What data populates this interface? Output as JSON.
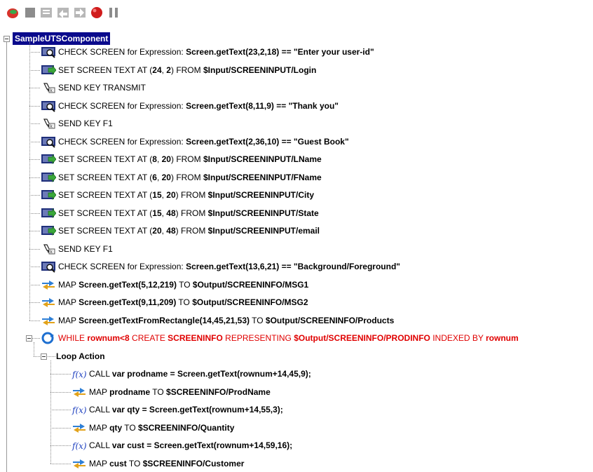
{
  "toolbar": {
    "icons": [
      "record-icon",
      "stop-icon",
      "step-into-icon",
      "step-over-icon",
      "step-out-icon",
      "breakpoint-icon",
      "pause-icon"
    ]
  },
  "tree": {
    "root": "SampleUTSComponent",
    "rows": [
      {
        "parts": [
          {
            "t": "CHECK SCREEN for Expression: ",
            "s": "kw"
          },
          {
            "t": "Screen.getText(23,2,18) == \"Enter your user-id\"",
            "s": "b"
          }
        ]
      },
      {
        "parts": [
          {
            "t": "SET SCREEN TEXT AT (",
            "s": "kw"
          },
          {
            "t": "24",
            "s": "b"
          },
          {
            "t": ", ",
            "s": "kw"
          },
          {
            "t": "2",
            "s": "b"
          },
          {
            "t": ") FROM ",
            "s": "kw"
          },
          {
            "t": "$Input/SCREENINPUT/Login",
            "s": "b"
          }
        ]
      },
      {
        "parts": [
          {
            "t": "SEND KEY TRANSMIT",
            "s": "kw"
          }
        ]
      },
      {
        "parts": [
          {
            "t": "CHECK SCREEN for Expression: ",
            "s": "kw"
          },
          {
            "t": "Screen.getText(8,11,9) == \"Thank you\"",
            "s": "b"
          }
        ]
      },
      {
        "parts": [
          {
            "t": "SEND KEY F1",
            "s": "kw"
          }
        ]
      },
      {
        "parts": [
          {
            "t": "CHECK SCREEN for Expression: ",
            "s": "kw"
          },
          {
            "t": "Screen.getText(2,36,10) == \"Guest Book\"",
            "s": "b"
          }
        ]
      },
      {
        "parts": [
          {
            "t": "SET SCREEN TEXT AT (",
            "s": "kw"
          },
          {
            "t": "8",
            "s": "b"
          },
          {
            "t": ", ",
            "s": "kw"
          },
          {
            "t": "20",
            "s": "b"
          },
          {
            "t": ") FROM ",
            "s": "kw"
          },
          {
            "t": "$Input/SCREENINPUT/LName",
            "s": "b"
          }
        ]
      },
      {
        "parts": [
          {
            "t": "SET SCREEN TEXT AT (",
            "s": "kw"
          },
          {
            "t": "6",
            "s": "b"
          },
          {
            "t": ", ",
            "s": "kw"
          },
          {
            "t": "20",
            "s": "b"
          },
          {
            "t": ") FROM ",
            "s": "kw"
          },
          {
            "t": "$Input/SCREENINPUT/FName",
            "s": "b"
          }
        ]
      },
      {
        "parts": [
          {
            "t": "SET SCREEN TEXT AT (",
            "s": "kw"
          },
          {
            "t": "15",
            "s": "b"
          },
          {
            "t": ", ",
            "s": "kw"
          },
          {
            "t": "20",
            "s": "b"
          },
          {
            "t": ") FROM ",
            "s": "kw"
          },
          {
            "t": "$Input/SCREENINPUT/City",
            "s": "b"
          }
        ]
      },
      {
        "parts": [
          {
            "t": "SET SCREEN TEXT AT (",
            "s": "kw"
          },
          {
            "t": "15",
            "s": "b"
          },
          {
            "t": ", ",
            "s": "kw"
          },
          {
            "t": "48",
            "s": "b"
          },
          {
            "t": ") FROM ",
            "s": "kw"
          },
          {
            "t": "$Input/SCREENINPUT/State",
            "s": "b"
          }
        ]
      },
      {
        "parts": [
          {
            "t": "SET SCREEN TEXT AT (",
            "s": "kw"
          },
          {
            "t": "20",
            "s": "b"
          },
          {
            "t": ", ",
            "s": "kw"
          },
          {
            "t": "48",
            "s": "b"
          },
          {
            "t": ") FROM ",
            "s": "kw"
          },
          {
            "t": "$Input/SCREENINPUT/email",
            "s": "b"
          }
        ]
      },
      {
        "parts": [
          {
            "t": "SEND KEY F1",
            "s": "kw"
          }
        ]
      },
      {
        "parts": [
          {
            "t": "CHECK SCREEN for Expression: ",
            "s": "kw"
          },
          {
            "t": "Screen.getText(13,6,21) == \"Background/Foreground\"",
            "s": "b"
          }
        ]
      },
      {
        "parts": [
          {
            "t": "MAP ",
            "s": "kw"
          },
          {
            "t": "Screen.getText(5,12,219)",
            "s": "b"
          },
          {
            "t": " TO ",
            "s": "kw"
          },
          {
            "t": "$Output/SCREENINFO/MSG1",
            "s": "b"
          }
        ]
      },
      {
        "parts": [
          {
            "t": "MAP ",
            "s": "kw"
          },
          {
            "t": "Screen.getText(9,11,209)",
            "s": "b"
          },
          {
            "t": " TO ",
            "s": "kw"
          },
          {
            "t": "$Output/SCREENINFO/MSG2",
            "s": "b"
          }
        ]
      },
      {
        "parts": [
          {
            "t": "MAP ",
            "s": "kw"
          },
          {
            "t": "Screen.getTextFromRectangle(14,45,21,53)",
            "s": "b"
          },
          {
            "t": " TO ",
            "s": "kw"
          },
          {
            "t": "$Output/SCREENINFO/Products",
            "s": "b"
          }
        ]
      },
      {
        "parts": [
          {
            "t": "WHILE ",
            "s": "kw red"
          },
          {
            "t": "rownum<8",
            "s": "b red"
          },
          {
            "t": " CREATE ",
            "s": "kw red"
          },
          {
            "t": "SCREENINFO",
            "s": "b red"
          },
          {
            "t": " REPRESENTING ",
            "s": "kw red"
          },
          {
            "t": "$Output/SCREENINFO/PRODINFO",
            "s": "b red"
          },
          {
            "t": " INDEXED BY ",
            "s": "kw red"
          },
          {
            "t": "rownum",
            "s": "b red"
          }
        ]
      },
      {
        "parts": [
          {
            "t": "Loop Action",
            "s": "b"
          }
        ]
      },
      {
        "parts": [
          {
            "t": "CALL ",
            "s": "kw"
          },
          {
            "t": "var prodname = Screen.getText(rownum+14,45,9);",
            "s": "b"
          }
        ]
      },
      {
        "parts": [
          {
            "t": "MAP ",
            "s": "kw"
          },
          {
            "t": "prodname",
            "s": "b"
          },
          {
            "t": " TO ",
            "s": "kw"
          },
          {
            "t": "$SCREENINFO/ProdName",
            "s": "b"
          }
        ]
      },
      {
        "parts": [
          {
            "t": "CALL ",
            "s": "kw"
          },
          {
            "t": "var qty = Screen.getText(rownum+14,55,3);",
            "s": "b"
          }
        ]
      },
      {
        "parts": [
          {
            "t": "MAP ",
            "s": "kw"
          },
          {
            "t": "qty",
            "s": "b"
          },
          {
            "t": " TO ",
            "s": "kw"
          },
          {
            "t": "$SCREENINFO/Quantity",
            "s": "b"
          }
        ]
      },
      {
        "parts": [
          {
            "t": "CALL ",
            "s": "kw"
          },
          {
            "t": "var cust = Screen.getText(rownum+14,59,16);",
            "s": "b"
          }
        ]
      },
      {
        "parts": [
          {
            "t": "MAP ",
            "s": "kw"
          },
          {
            "t": "cust",
            "s": "b"
          },
          {
            "t": " TO ",
            "s": "kw"
          },
          {
            "t": "$SCREENINFO/Customer",
            "s": "b"
          }
        ]
      }
    ]
  }
}
